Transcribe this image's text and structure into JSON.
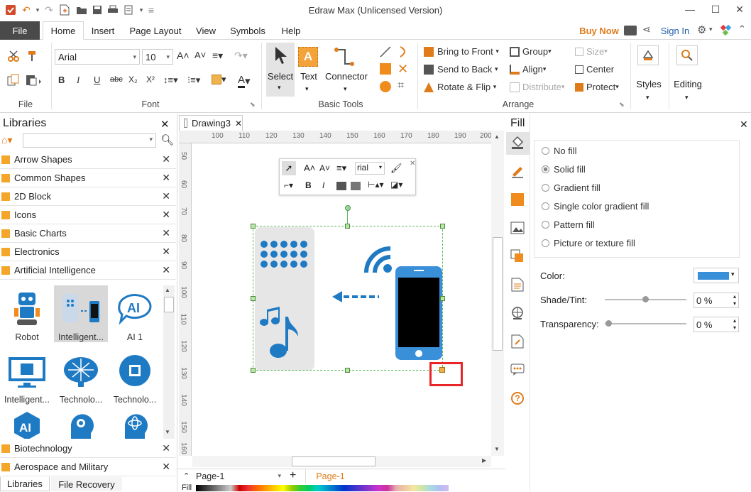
{
  "app": {
    "title": "Edraw Max (Unlicensed Version)"
  },
  "menu": {
    "file": "File",
    "tabs": [
      "Home",
      "Insert",
      "Page Layout",
      "View",
      "Symbols",
      "Help"
    ],
    "buy_now": "Buy Now",
    "sign_in": "Sign In"
  },
  "ribbon": {
    "font_name": "Arial",
    "font_size": "10",
    "groups": {
      "file": "File",
      "font": "Font",
      "basic_tools": "Basic Tools",
      "arrange": "Arrange"
    },
    "tools": {
      "select": "Select",
      "text": "Text",
      "connector": "Connector",
      "styles": "Styles",
      "editing": "Editing"
    },
    "arrange": {
      "bring_front": "Bring to Front",
      "send_back": "Send to Back",
      "rotate_flip": "Rotate & Flip",
      "group": "Group",
      "align": "Align",
      "distribute": "Distribute",
      "size": "Size",
      "center": "Center",
      "protect": "Protect"
    }
  },
  "libraries": {
    "title": "Libraries",
    "search_placeholder": "",
    "categories": [
      "Arrow Shapes",
      "Common Shapes",
      "2D Block",
      "Icons",
      "Basic Charts",
      "Electronics",
      "Artificial Intelligence"
    ],
    "shapes": [
      "Robot",
      "Intelligent...",
      "AI 1",
      "Intelligent...",
      "Technolo...",
      "Technolo...",
      "",
      "",
      ""
    ],
    "bottom_categories": [
      "Biotechnology",
      "Aerospace and Military"
    ],
    "bottom_tabs": [
      "Libraries",
      "File Recovery"
    ]
  },
  "document": {
    "tab": "Drawing3",
    "page_select": "Page-1",
    "page_tab": "Page-1",
    "fill_label": "Fill"
  },
  "ruler": {
    "h": [
      "100",
      "110",
      "120",
      "130",
      "140",
      "150",
      "160",
      "170",
      "180",
      "190",
      "200"
    ],
    "v": [
      "50",
      "60",
      "70",
      "80",
      "90",
      "100",
      "110",
      "120",
      "130",
      "140",
      "150",
      "160"
    ]
  },
  "mini_toolbar": {
    "font": "rial"
  },
  "fill_panel": {
    "title": "Fill",
    "options": [
      "No fill",
      "Solid fill",
      "Gradient fill",
      "Single color gradient fill",
      "Pattern fill",
      "Picture or texture fill"
    ],
    "selected": "Solid fill",
    "color_label": "Color:",
    "color_value": "#3a8fd9",
    "shade_label": "Shade/Tint:",
    "shade_value": "0 %",
    "transparency_label": "Transparency:",
    "transparency_value": "0 %"
  },
  "colors": {
    "accent": "#f08c1e",
    "brand_blue": "#1f7ac4",
    "highlight_red": "#e8262a"
  }
}
